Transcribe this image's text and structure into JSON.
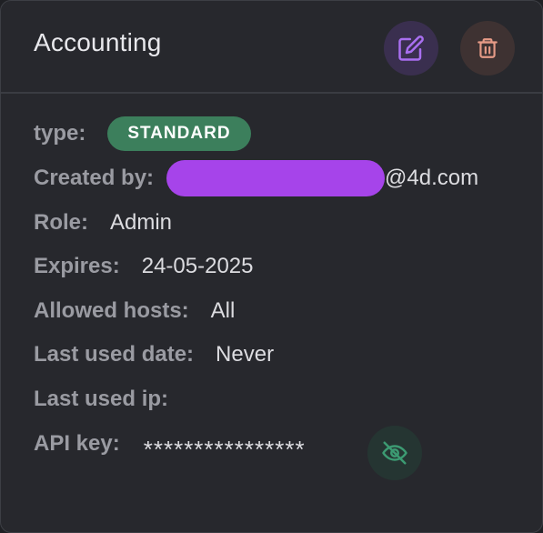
{
  "card": {
    "title": "Accounting",
    "actions": {
      "edit_icon": "edit-icon",
      "delete_icon": "trash-icon"
    }
  },
  "details": {
    "type": {
      "label": "type:",
      "value": "STANDARD"
    },
    "created_by": {
      "label": "Created by:",
      "value_suffix": "@4d.com"
    },
    "role": {
      "label": "Role:",
      "value": "Admin"
    },
    "expires": {
      "label": "Expires:",
      "value": "24-05-2025"
    },
    "allowed_hosts": {
      "label": "Allowed hosts:",
      "value": "All"
    },
    "last_used_date": {
      "label": "Last used date:",
      "value": "Never"
    },
    "last_used_ip": {
      "label": "Last used ip:",
      "value": ""
    },
    "api_key": {
      "label": "API key:",
      "value": "****************",
      "toggle_icon": "eye-off-icon"
    }
  },
  "colors": {
    "badge": "#3c7f5c",
    "redaction": "#a644ea",
    "edit_accent": "#a96ff0",
    "delete_accent": "#e59a86",
    "visibility_accent": "#3c9a72"
  }
}
